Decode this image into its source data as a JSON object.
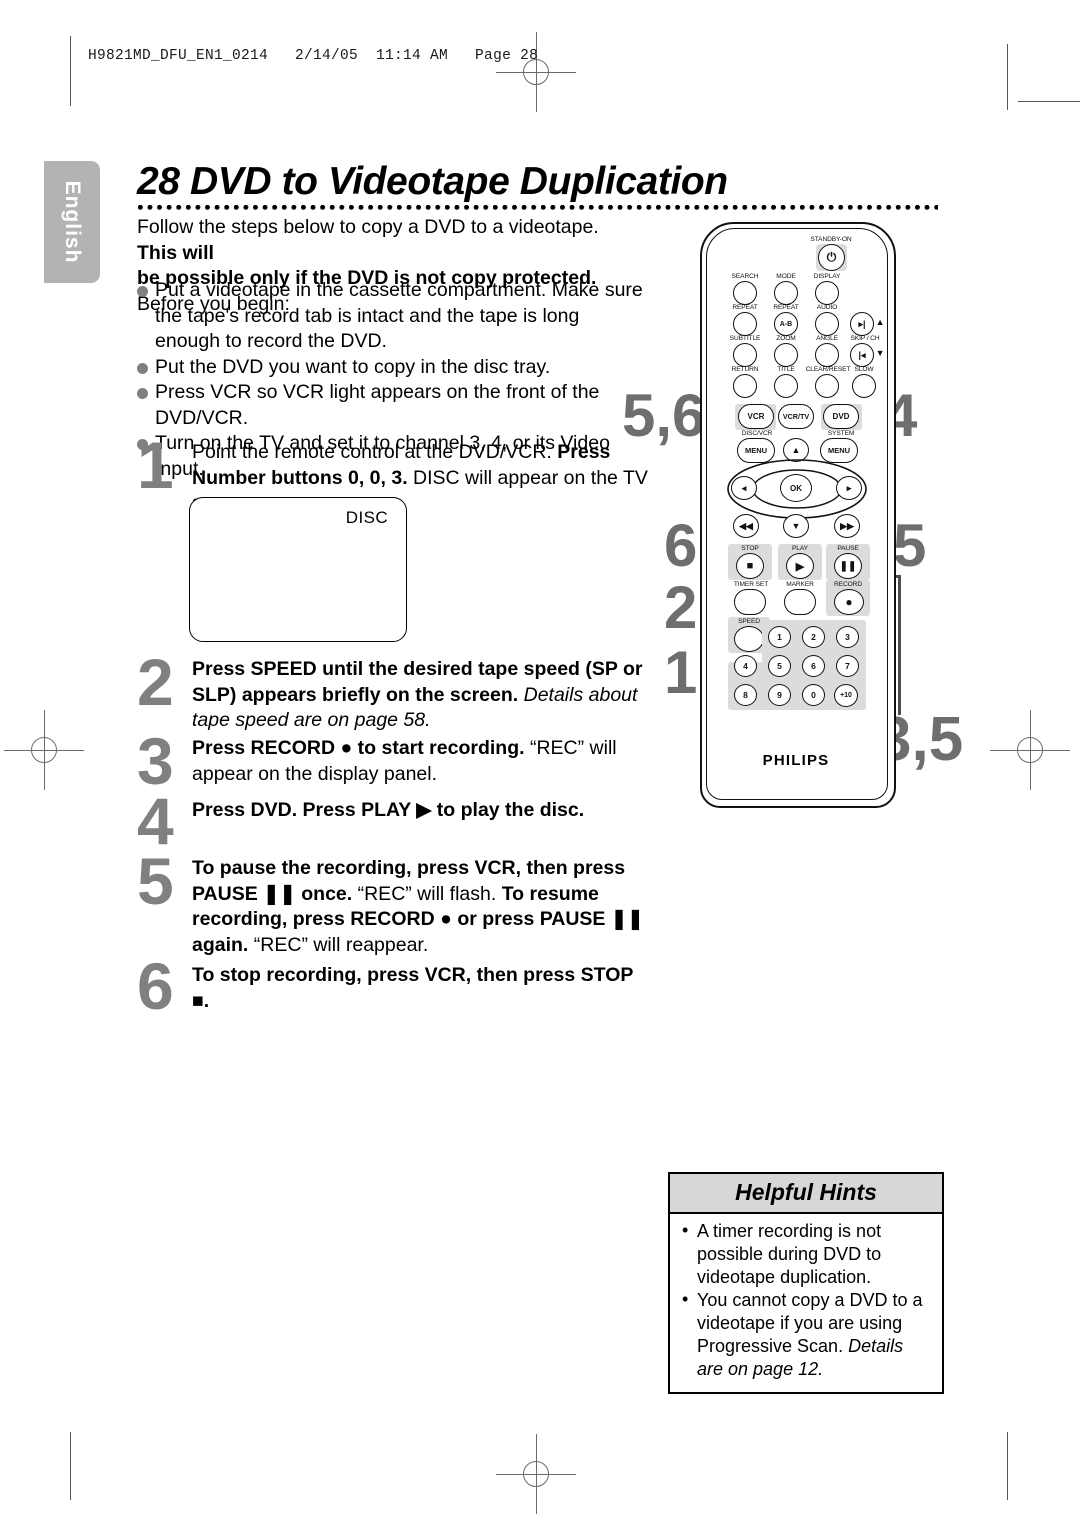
{
  "print_slug": "H9821MD_DFU_EN1_0214   2/14/05  11:14 AM   Page 28",
  "language_tab": "English",
  "page_title": "28  DVD to Videotape Duplication",
  "intro": {
    "line1_plain": "Follow the steps below to copy a DVD to a videotape. ",
    "line1_bold": "This will",
    "line2_bold": "be possible only if the DVD is not copy protected.",
    "line3": "Before you begin:"
  },
  "bullets": [
    "Put a videotape in the cassette compartment. Make sure the tape's record tab is intact and the tape is long enough to record the DVD.",
    "Put the DVD you want to copy in the disc tray.",
    "Press VCR so VCR light appears on the front of the DVD/VCR.",
    "Turn on the TV and set it to channel 3, 4, or its Video Input."
  ],
  "steps": [
    {
      "num": "1",
      "html": "Point the remote control at the DVD/VCR. <b>Press Number buttons 0, 0, 3.</b> DISC will appear on the TV screen."
    },
    {
      "num": "2",
      "html": "<b>Press SPEED until the desired tape speed (SP or SLP) appears briefly on the screen.</b> <i>Details about tape speed are on page 58.</i>"
    },
    {
      "num": "3",
      "html": "<b>Press RECORD ● to start recording.</b> “REC” will appear on the display panel."
    },
    {
      "num": "4",
      "html": "<b>Press DVD.  Press PLAY ▶ to play the disc.</b>"
    },
    {
      "num": "5",
      "html": "<b>To pause the recording, press VCR, then press PAUSE ❚❚ once.</b> “REC” will flash. <b>To resume recording, press RECORD ● or press PAUSE ❚❚ again.</b> “REC” will reappear."
    },
    {
      "num": "6",
      "html": "<b>To stop recording, press VCR, then press STOP ■.</b>"
    }
  ],
  "tv_screen": {
    "osd_text": "DISC"
  },
  "helpful_hints": {
    "title": "Helpful Hints",
    "items": [
      {
        "plain": "A timer recording is not possible during DVD to videotape duplication.",
        "italic": ""
      },
      {
        "plain": "You cannot copy a DVD to a videotape if you are using Progressive Scan. ",
        "italic": "Details are on page 12."
      }
    ]
  },
  "remote": {
    "brand": "PHILIPS",
    "standby_label": "STANDBY-ON",
    "labels_row1": [
      "SEARCH",
      "MODE",
      "DISPLAY"
    ],
    "labels_row2": [
      "REPEAT",
      "REPEAT",
      "AUDIO"
    ],
    "key_ab": "A-B",
    "labels_row3": [
      "SUBTITLE",
      "ZOOM",
      "ANGLE",
      "SKIP / CH"
    ],
    "labels_row4": [
      "RETURN",
      "TITLE",
      "CLEAR/RESET",
      "SLOW"
    ],
    "mode_keys": [
      "VCR",
      "VCR/TV",
      "DVD"
    ],
    "menu_labels": [
      "DISC/VCR",
      "SYSTEM"
    ],
    "menu_keys": [
      "MENU",
      "MENU"
    ],
    "ok_key": "OK",
    "transport_labels": [
      "STOP",
      "PLAY",
      "PAUSE"
    ],
    "aux_labels": [
      "TIMER SET",
      "MARKER",
      "RECORD"
    ],
    "speed_label": "SPEED",
    "numpad": [
      "1",
      "2",
      "3",
      "4",
      "5",
      "6",
      "7",
      "8",
      "9",
      "0",
      "+10"
    ]
  },
  "callouts": [
    {
      "id": "callout-5-6",
      "text": "5,6"
    },
    {
      "id": "callout-4",
      "text": "4"
    },
    {
      "id": "callout-6",
      "text": "6"
    },
    {
      "id": "callout-5",
      "text": "5"
    },
    {
      "id": "callout-2",
      "text": "2"
    },
    {
      "id": "callout-1",
      "text": "1"
    },
    {
      "id": "callout-3-5",
      "text": "3,5"
    }
  ],
  "colors": {
    "step_number_grey": "#808080",
    "callout_grey": "#6e6e6e",
    "tab_grey": "#b3b3b3",
    "hint_header_grey": "#d7d7d7",
    "key_highlight_grey": "#dcdcdc"
  }
}
